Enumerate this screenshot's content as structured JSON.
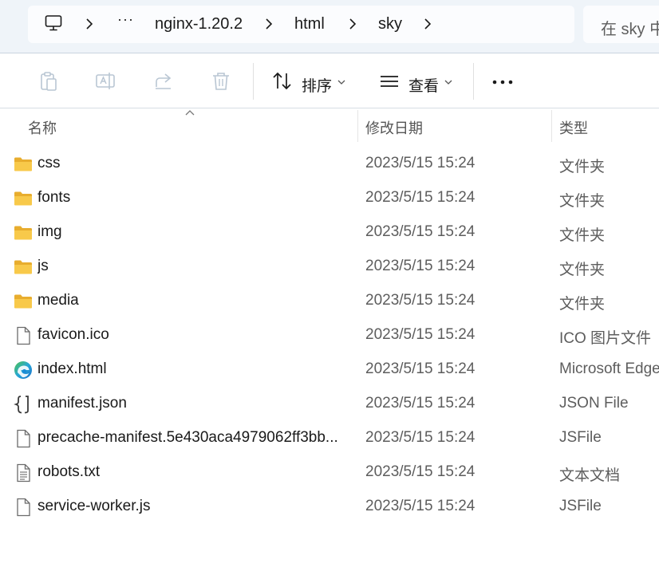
{
  "address_bar": {
    "breadcrumbs": [
      {
        "label": "nginx-1.20.2"
      },
      {
        "label": "html"
      },
      {
        "label": "sky"
      }
    ],
    "overflow_label": "···",
    "search_placeholder": "在 sky 中"
  },
  "toolbar": {
    "sort_label": "排序",
    "view_label": "查看",
    "more_label": "···"
  },
  "columns": {
    "name": "名称",
    "date": "修改日期",
    "type": "类型"
  },
  "files": [
    {
      "name": "css",
      "date": "2023/5/15 15:24",
      "type": "文件夹",
      "icon": "folder-icon"
    },
    {
      "name": "fonts",
      "date": "2023/5/15 15:24",
      "type": "文件夹",
      "icon": "folder-icon"
    },
    {
      "name": "img",
      "date": "2023/5/15 15:24",
      "type": "文件夹",
      "icon": "folder-icon"
    },
    {
      "name": "js",
      "date": "2023/5/15 15:24",
      "type": "文件夹",
      "icon": "folder-icon"
    },
    {
      "name": "media",
      "date": "2023/5/15 15:24",
      "type": "文件夹",
      "icon": "folder-icon"
    },
    {
      "name": "favicon.ico",
      "date": "2023/5/15 15:24",
      "type": "ICO 图片文件",
      "icon": "file-icon"
    },
    {
      "name": "index.html",
      "date": "2023/5/15 15:24",
      "type": "Microsoft Edge",
      "icon": "edge-icon"
    },
    {
      "name": "manifest.json",
      "date": "2023/5/15 15:24",
      "type": "JSON File",
      "icon": "json-file-icon"
    },
    {
      "name": "precache-manifest.5e430aca4979062ff3bb...",
      "date": "2023/5/15 15:24",
      "type": "JSFile",
      "icon": "file-icon"
    },
    {
      "name": "robots.txt",
      "date": "2023/5/15 15:24",
      "type": "文本文档",
      "icon": "text-file-icon"
    },
    {
      "name": "service-worker.js",
      "date": "2023/5/15 15:24",
      "type": "JSFile",
      "icon": "file-icon"
    }
  ],
  "colors": {
    "address_bg": "#eff4f9",
    "folder_yellow": "#f8c94a",
    "edge_blue": "#1a8bd6",
    "edge_green": "#4fc34a"
  }
}
